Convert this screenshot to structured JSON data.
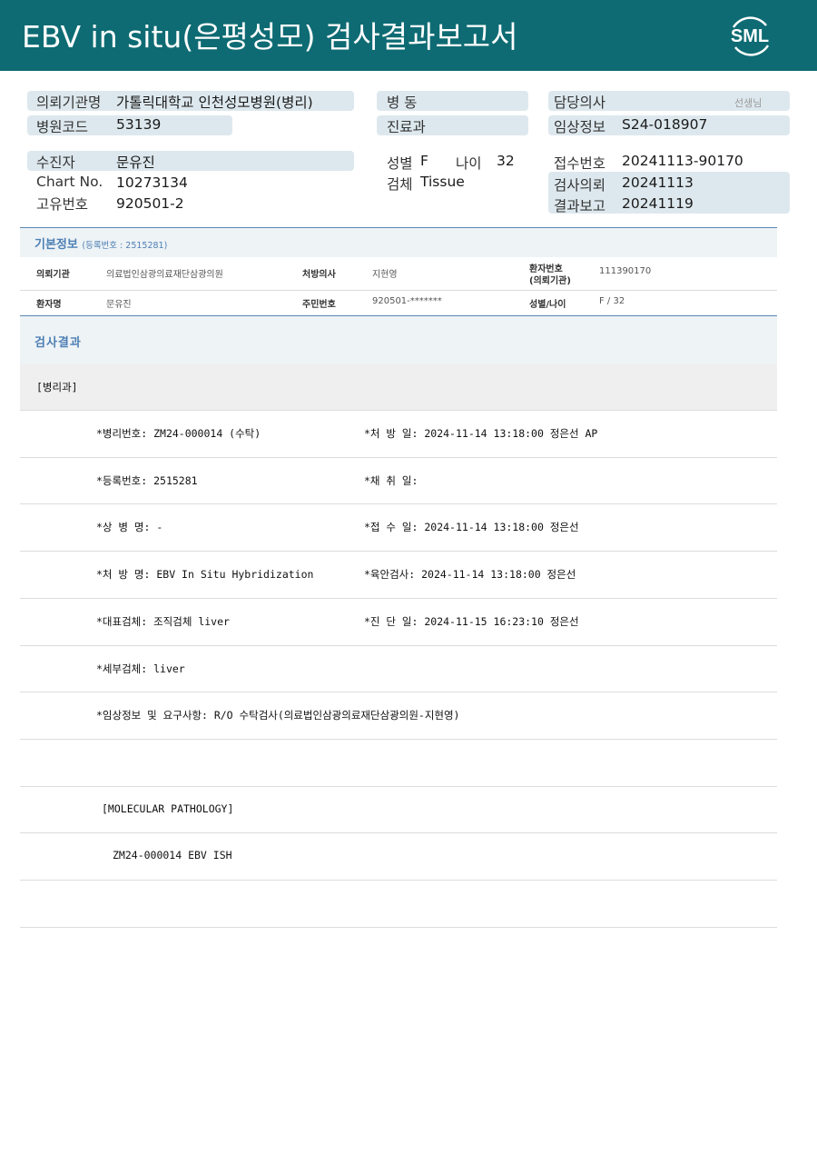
{
  "header": {
    "title": "EBV in situ(은평성모) 검사결과보고서",
    "logo_text": "SML",
    "bg_color": "#0e6b73"
  },
  "top": {
    "institution_label": "의뢰기관명",
    "institution_value": "가톨릭대학교 인천성모병원(병리)",
    "hospital_code_label": "병원코드",
    "hospital_code_value": "53139",
    "ward_label": "병 동",
    "department_label": "진료과",
    "doctor_label": "담당의사",
    "doctor_suffix": "선생님",
    "clinical_info_label": "임상정보",
    "clinical_info_value": "S24-018907",
    "patient_label": "수진자",
    "patient_value": "문유진",
    "chart_label": "Chart No.",
    "chart_value": "10273134",
    "unique_label": "고유번호",
    "unique_value": "920501-2",
    "sex_label": "성별",
    "sex_value": "F",
    "age_label": "나이",
    "age_value": "32",
    "specimen_label": "검체",
    "specimen_value": "Tissue",
    "receipt_label": "접수번호",
    "receipt_value": "20241113-90170",
    "request_label": "검사의뢰",
    "request_value": "20241113",
    "report_label": "결과보고",
    "report_value": "20241119"
  },
  "basic": {
    "title": "기본정보",
    "reg_sub": "(등록번호 : 2515281)",
    "row1": {
      "inst_label": "의뢰기관",
      "inst_value": "의료법인삼광의료재단삼광의원",
      "presc_label": "처방의사",
      "presc_value": "지현영",
      "patno_label_1": "환자번호",
      "patno_label_2": "(의뢰기관)",
      "patno_value": "111390170"
    },
    "row2": {
      "name_label": "환자명",
      "name_value": "문유진",
      "rrn_label": "주민번호",
      "rrn_value": "920501-*******",
      "sexage_label": "성별/나이",
      "sexage_value": "F / 32"
    }
  },
  "results": {
    "title": "검사결과",
    "dept": "[병리과]",
    "lines": [
      {
        "left": "*병리번호: ZM24-000014 (수탁)",
        "right": "*처 방 일: 2024-11-14 13:18:00  정은선 AP"
      },
      {
        "left": "*등록번호: 2515281",
        "right": "*채 취 일:"
      },
      {
        "left": "*상 병 명: -",
        "right": "*접 수 일: 2024-11-14 13:18:00  정은선"
      },
      {
        "left": "*처 방 명: EBV In Situ Hybridization",
        "right": "*육안검사: 2024-11-14 13:18:00  정은선"
      },
      {
        "left": "*대표검체: 조직검체 liver",
        "right": "*진 단 일: 2024-11-15 16:23:10  정은선"
      },
      {
        "left": "*세부검체: liver",
        "right": ""
      },
      {
        "left": "*임상정보 및 요구사항: R/O 수탁검사(의료법인삼광의료재단삼광의원-지현영)",
        "right": ""
      },
      {
        "left": "",
        "right": ""
      },
      {
        "left": "[MOLECULAR PATHOLOGY]",
        "right": ""
      },
      {
        "left": "ZM24-000014    EBV ISH",
        "right": ""
      },
      {
        "left": "",
        "right": ""
      }
    ]
  }
}
